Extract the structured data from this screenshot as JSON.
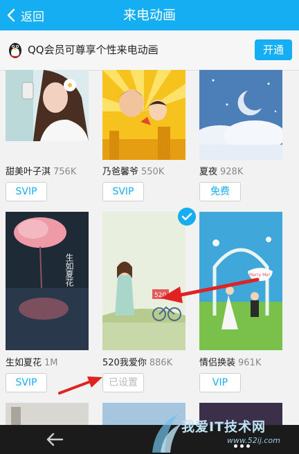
{
  "header": {
    "back_label": "返回",
    "title": "来电动画"
  },
  "promo": {
    "text": "QQ会员可尊享个性来电动画",
    "button": "开通"
  },
  "items": [
    {
      "name": "甜美叶子淇",
      "size": "756K",
      "tag": "SVIP"
    },
    {
      "name": "乃爸馨爷",
      "size": "550K",
      "tag": "SVIP"
    },
    {
      "name": "夏夜",
      "size": "928K",
      "tag": "免费"
    },
    {
      "name": "生如夏花",
      "size": "1M",
      "tag": "SVIP"
    },
    {
      "name": "520我爱你",
      "size": "886K",
      "tag": "已设置",
      "selected": true
    },
    {
      "name": "情侣换装",
      "size": "961K",
      "tag": "VIP"
    }
  ],
  "thumb_texts": {
    "summer_flower_title": "生如夏花",
    "love_sign": "520",
    "marry_sign": "Marry Me!"
  },
  "watermark": {
    "text": "我爱IT技术网",
    "url": "www.52ij.com"
  },
  "colors": {
    "accent": "#16aef2",
    "arrow": "#e02222",
    "disabled_text": "#bbbbbb"
  }
}
